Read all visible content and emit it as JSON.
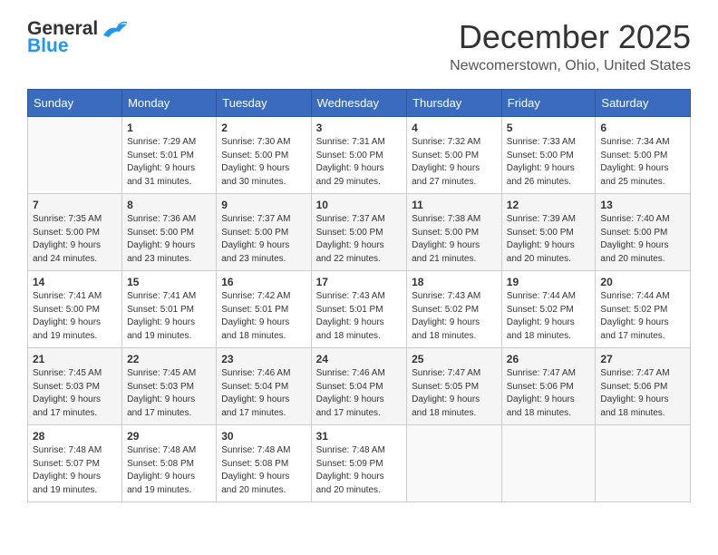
{
  "header": {
    "logo_general": "General",
    "logo_blue": "Blue",
    "title": "December 2025",
    "location": "Newcomerstown, Ohio, United States"
  },
  "columns": [
    "Sunday",
    "Monday",
    "Tuesday",
    "Wednesday",
    "Thursday",
    "Friday",
    "Saturday"
  ],
  "weeks": [
    [
      {
        "day": "",
        "sunrise": "",
        "sunset": "",
        "daylight": ""
      },
      {
        "day": "1",
        "sunrise": "7:29 AM",
        "sunset": "5:01 PM",
        "daylight": "9 hours and 31 minutes."
      },
      {
        "day": "2",
        "sunrise": "7:30 AM",
        "sunset": "5:00 PM",
        "daylight": "9 hours and 30 minutes."
      },
      {
        "day": "3",
        "sunrise": "7:31 AM",
        "sunset": "5:00 PM",
        "daylight": "9 hours and 29 minutes."
      },
      {
        "day": "4",
        "sunrise": "7:32 AM",
        "sunset": "5:00 PM",
        "daylight": "9 hours and 27 minutes."
      },
      {
        "day": "5",
        "sunrise": "7:33 AM",
        "sunset": "5:00 PM",
        "daylight": "9 hours and 26 minutes."
      },
      {
        "day": "6",
        "sunrise": "7:34 AM",
        "sunset": "5:00 PM",
        "daylight": "9 hours and 25 minutes."
      }
    ],
    [
      {
        "day": "7",
        "sunrise": "7:35 AM",
        "sunset": "5:00 PM",
        "daylight": "9 hours and 24 minutes."
      },
      {
        "day": "8",
        "sunrise": "7:36 AM",
        "sunset": "5:00 PM",
        "daylight": "9 hours and 23 minutes."
      },
      {
        "day": "9",
        "sunrise": "7:37 AM",
        "sunset": "5:00 PM",
        "daylight": "9 hours and 23 minutes."
      },
      {
        "day": "10",
        "sunrise": "7:37 AM",
        "sunset": "5:00 PM",
        "daylight": "9 hours and 22 minutes."
      },
      {
        "day": "11",
        "sunrise": "7:38 AM",
        "sunset": "5:00 PM",
        "daylight": "9 hours and 21 minutes."
      },
      {
        "day": "12",
        "sunrise": "7:39 AM",
        "sunset": "5:00 PM",
        "daylight": "9 hours and 20 minutes."
      },
      {
        "day": "13",
        "sunrise": "7:40 AM",
        "sunset": "5:00 PM",
        "daylight": "9 hours and 20 minutes."
      }
    ],
    [
      {
        "day": "14",
        "sunrise": "7:41 AM",
        "sunset": "5:00 PM",
        "daylight": "9 hours and 19 minutes."
      },
      {
        "day": "15",
        "sunrise": "7:41 AM",
        "sunset": "5:01 PM",
        "daylight": "9 hours and 19 minutes."
      },
      {
        "day": "16",
        "sunrise": "7:42 AM",
        "sunset": "5:01 PM",
        "daylight": "9 hours and 18 minutes."
      },
      {
        "day": "17",
        "sunrise": "7:43 AM",
        "sunset": "5:01 PM",
        "daylight": "9 hours and 18 minutes."
      },
      {
        "day": "18",
        "sunrise": "7:43 AM",
        "sunset": "5:02 PM",
        "daylight": "9 hours and 18 minutes."
      },
      {
        "day": "19",
        "sunrise": "7:44 AM",
        "sunset": "5:02 PM",
        "daylight": "9 hours and 18 minutes."
      },
      {
        "day": "20",
        "sunrise": "7:44 AM",
        "sunset": "5:02 PM",
        "daylight": "9 hours and 17 minutes."
      }
    ],
    [
      {
        "day": "21",
        "sunrise": "7:45 AM",
        "sunset": "5:03 PM",
        "daylight": "9 hours and 17 minutes."
      },
      {
        "day": "22",
        "sunrise": "7:45 AM",
        "sunset": "5:03 PM",
        "daylight": "9 hours and 17 minutes."
      },
      {
        "day": "23",
        "sunrise": "7:46 AM",
        "sunset": "5:04 PM",
        "daylight": "9 hours and 17 minutes."
      },
      {
        "day": "24",
        "sunrise": "7:46 AM",
        "sunset": "5:04 PM",
        "daylight": "9 hours and 17 minutes."
      },
      {
        "day": "25",
        "sunrise": "7:47 AM",
        "sunset": "5:05 PM",
        "daylight": "9 hours and 18 minutes."
      },
      {
        "day": "26",
        "sunrise": "7:47 AM",
        "sunset": "5:06 PM",
        "daylight": "9 hours and 18 minutes."
      },
      {
        "day": "27",
        "sunrise": "7:47 AM",
        "sunset": "5:06 PM",
        "daylight": "9 hours and 18 minutes."
      }
    ],
    [
      {
        "day": "28",
        "sunrise": "7:48 AM",
        "sunset": "5:07 PM",
        "daylight": "9 hours and 19 minutes."
      },
      {
        "day": "29",
        "sunrise": "7:48 AM",
        "sunset": "5:08 PM",
        "daylight": "9 hours and 19 minutes."
      },
      {
        "day": "30",
        "sunrise": "7:48 AM",
        "sunset": "5:08 PM",
        "daylight": "9 hours and 20 minutes."
      },
      {
        "day": "31",
        "sunrise": "7:48 AM",
        "sunset": "5:09 PM",
        "daylight": "9 hours and 20 minutes."
      },
      {
        "day": "",
        "sunrise": "",
        "sunset": "",
        "daylight": ""
      },
      {
        "day": "",
        "sunrise": "",
        "sunset": "",
        "daylight": ""
      },
      {
        "day": "",
        "sunrise": "",
        "sunset": "",
        "daylight": ""
      }
    ]
  ],
  "labels": {
    "sunrise_label": "Sunrise:",
    "sunset_label": "Sunset:",
    "daylight_label": "Daylight:"
  }
}
